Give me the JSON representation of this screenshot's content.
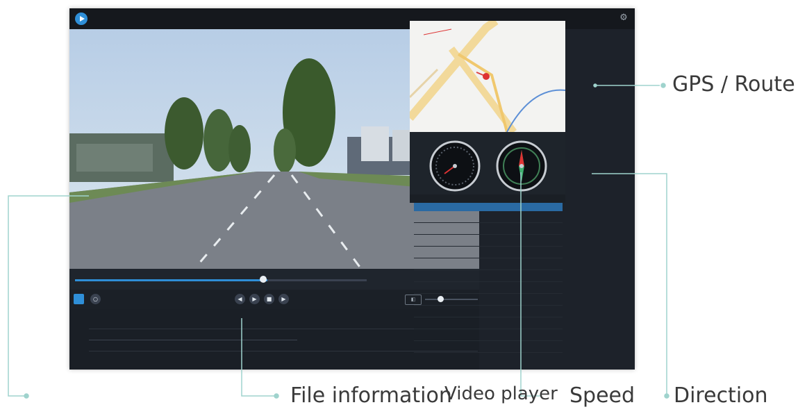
{
  "app": {
    "title": "",
    "status": "",
    "colors": {
      "accent": "#2f8fd8",
      "callout_line": "#9fd3cd"
    }
  },
  "video": {
    "overlay_left": "",
    "overlay_right": ""
  },
  "player": {
    "progress": 0.66,
    "time": "",
    "volume": 0.3
  },
  "graph": {
    "labels": [
      "",
      "",
      "",
      "",
      ""
    ]
  },
  "panel": {
    "gauges": [
      "speedometer",
      "compass"
    ],
    "table_headers": [
      "",
      "",
      "",
      ""
    ],
    "selected_row": [
      "",
      "",
      "",
      ""
    ]
  },
  "callouts": {
    "gps_route": "GPS / Route",
    "file_information": "File information",
    "video_player": "Video player",
    "speed": "Speed",
    "direction": "Direction"
  }
}
